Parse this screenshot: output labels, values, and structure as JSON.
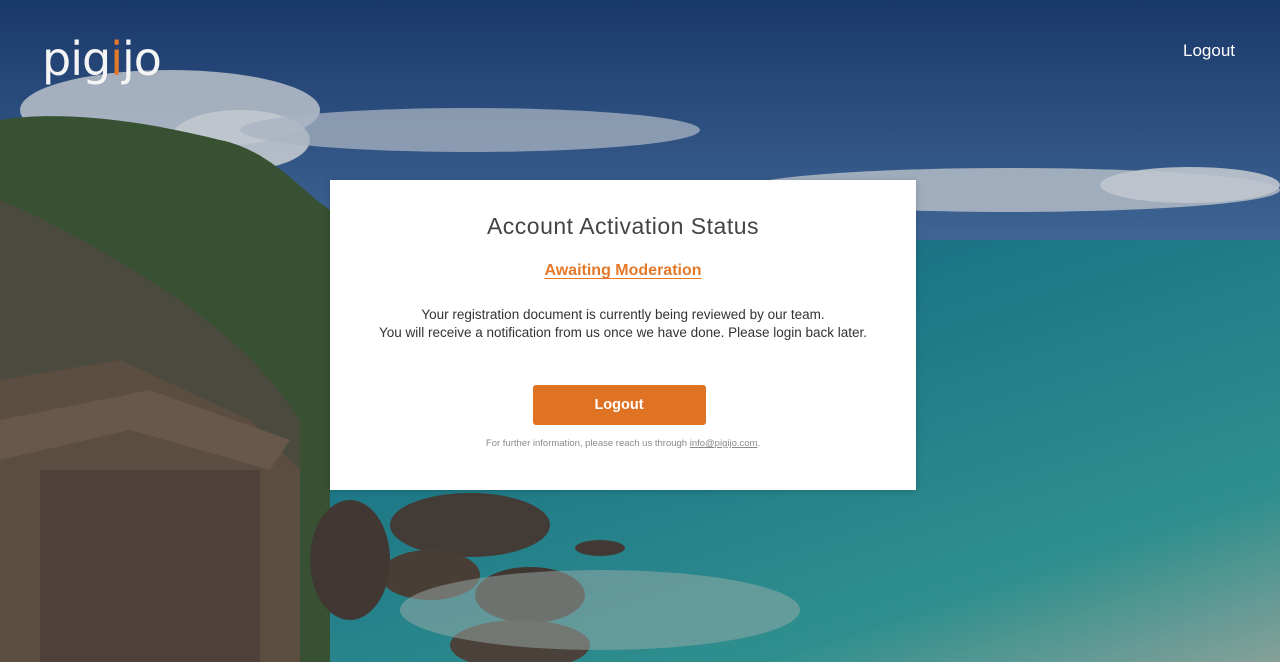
{
  "header": {
    "logo_text_pre": "pig",
    "logo_text_accent": "i",
    "logo_text_post": "jo",
    "logout_label": "Logout"
  },
  "card": {
    "title": "Account Activation Status",
    "status": "Awaiting Moderation",
    "message_line1": "Your registration document is currently being reviewed by our team.",
    "message_line2": "You will receive a notification from us once we have done. Please login back later.",
    "button_label": "Logout",
    "footer_text": "For further information, please reach us through ",
    "footer_email": "info@pigijo.com",
    "footer_end": "."
  },
  "colors": {
    "accent": "#e07224",
    "card_bg": "#ffffff",
    "title_text": "#444444"
  }
}
